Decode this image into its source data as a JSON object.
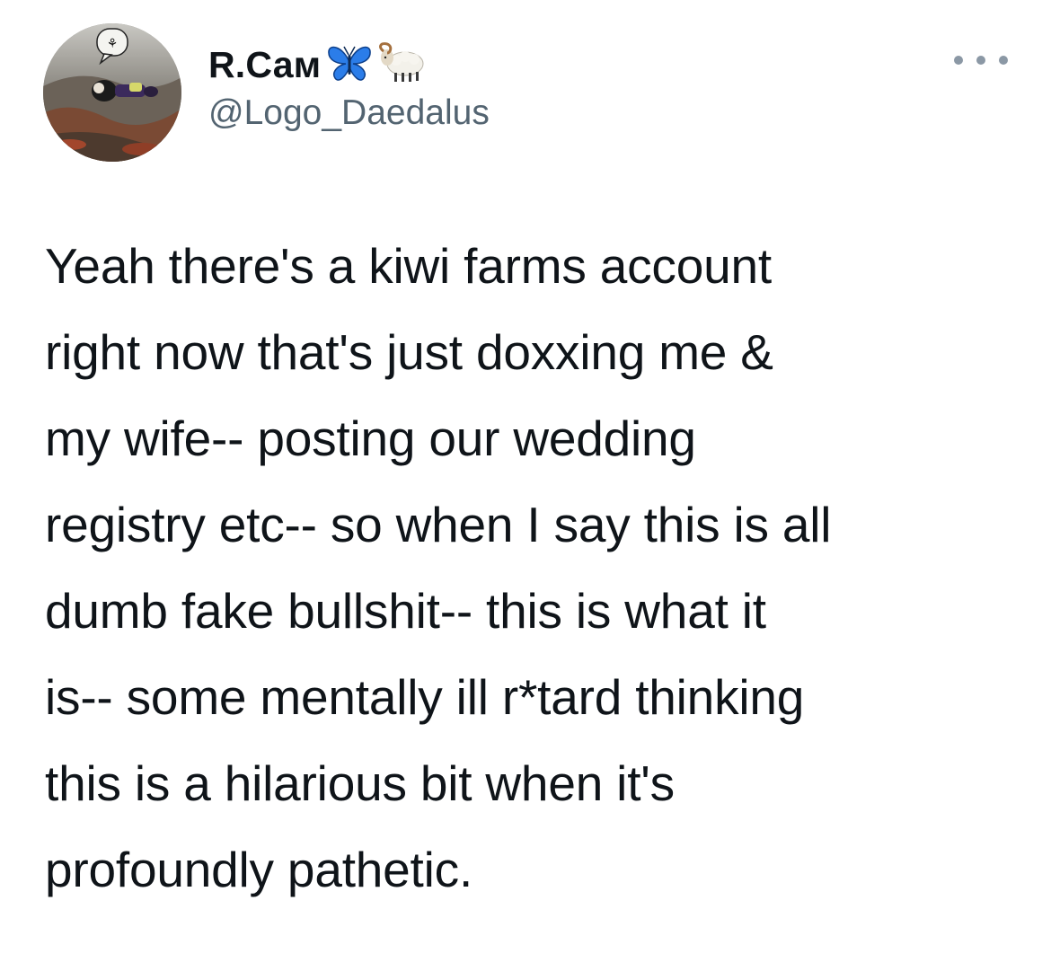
{
  "tweet": {
    "author": {
      "display_name": "R.Сам",
      "name_emojis": [
        "butterfly-icon",
        "ram-icon"
      ],
      "handle": "@Logo_Daedalus",
      "avatar": "avatar"
    },
    "more_icon": "more-horizontal-icon",
    "text_lines": [
      "Yeah there's a kiwi farms account",
      "right now that's just doxxing me &",
      "my wife-- posting our wedding",
      "registry etc-- so when I say this is all",
      "dumb fake bullshit-- this is what it",
      "is-- some mentally ill r*tard thinking",
      "this is a hilarious bit when it's",
      "profoundly pathetic."
    ]
  },
  "colors": {
    "text": "#0f1419",
    "secondary": "#536471",
    "butterfly": "#2b7de9",
    "background": "#ffffff"
  }
}
